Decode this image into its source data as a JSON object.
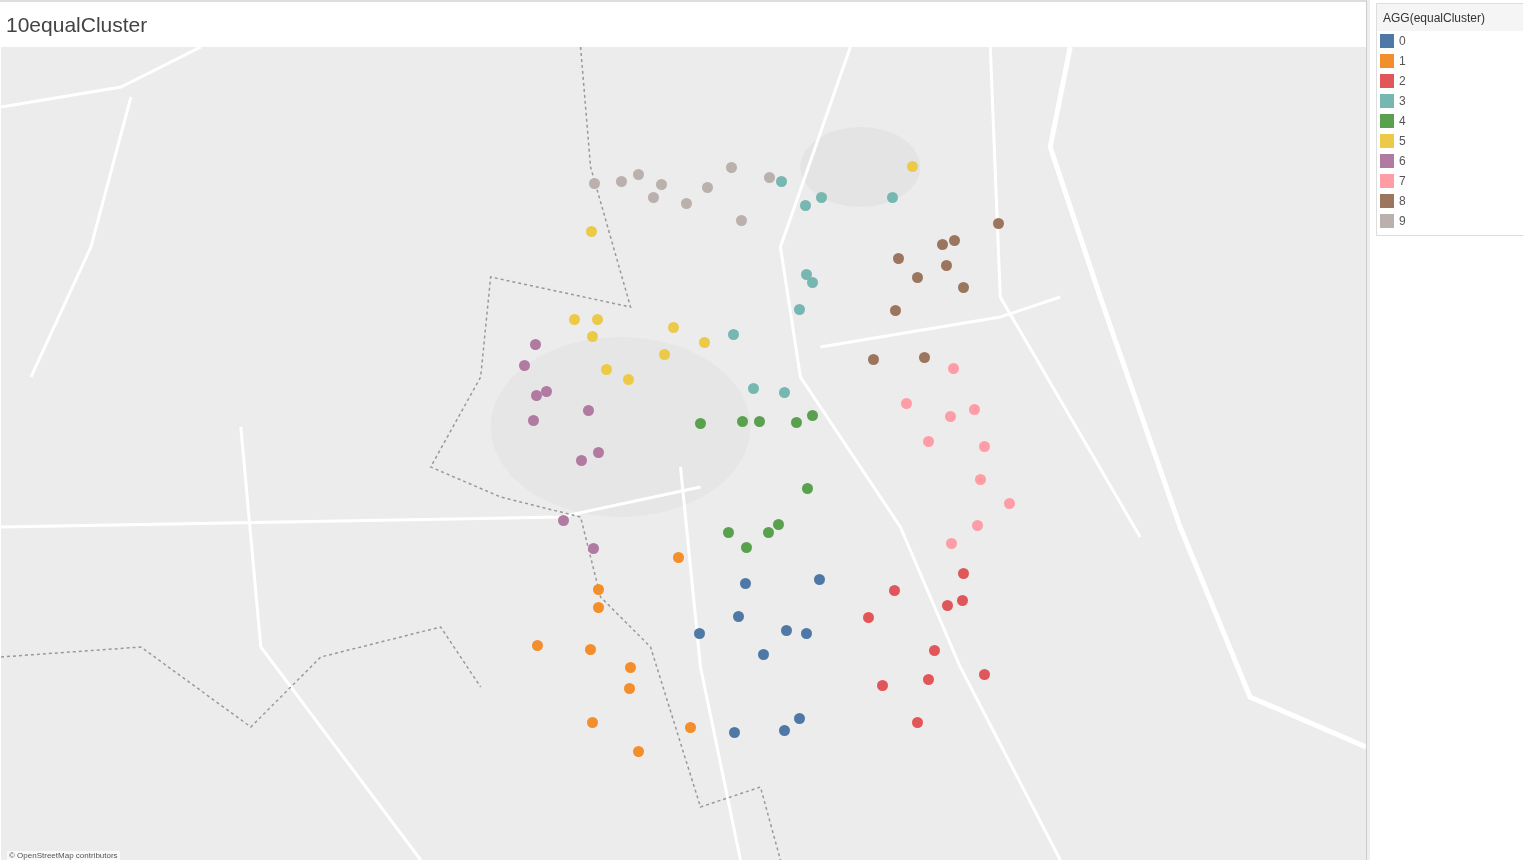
{
  "title": "10equalCluster",
  "map": {
    "attribution": "© OpenStreetMap contributors",
    "markers": [
      {
        "color": "#bab0ac"
      },
      {
        "color": "#bab0ac"
      },
      {
        "color": "#bab0ac"
      },
      {
        "color": "#bab0ac"
      },
      {
        "color": "#bab0ac"
      },
      {
        "color": "#bab0ac"
      },
      {
        "color": "#bab0ac"
      },
      {
        "color": "#bab0ac"
      },
      {
        "color": "#bab0ac"
      },
      {
        "color": "#bab0ac"
      },
      {
        "color": "#76b7b2"
      },
      {
        "color": "#76b7b2"
      },
      {
        "color": "#76b7b2"
      },
      {
        "color": "#76b7b2"
      },
      {
        "color": "#76b7b2"
      },
      {
        "color": "#76b7b2"
      },
      {
        "color": "#76b7b2"
      },
      {
        "color": "#76b7b2"
      },
      {
        "color": "#76b7b2"
      },
      {
        "color": "#76b7b2"
      },
      {
        "color": "#edc948"
      },
      {
        "color": "#edc948"
      },
      {
        "color": "#edc948"
      },
      {
        "color": "#edc948"
      },
      {
        "color": "#edc948"
      },
      {
        "color": "#edc948"
      },
      {
        "color": "#edc948"
      },
      {
        "color": "#edc948"
      },
      {
        "color": "#edc948"
      },
      {
        "color": "#edc948"
      },
      {
        "color": "#9c755f"
      },
      {
        "color": "#9c755f"
      },
      {
        "color": "#9c755f"
      },
      {
        "color": "#9c755f"
      },
      {
        "color": "#9c755f"
      },
      {
        "color": "#9c755f"
      },
      {
        "color": "#9c755f"
      },
      {
        "color": "#9c755f"
      },
      {
        "color": "#9c755f"
      },
      {
        "color": "#9c755f"
      },
      {
        "color": "#b07aa1"
      },
      {
        "color": "#b07aa1"
      },
      {
        "color": "#b07aa1"
      },
      {
        "color": "#b07aa1"
      },
      {
        "color": "#b07aa1"
      },
      {
        "color": "#b07aa1"
      },
      {
        "color": "#b07aa1"
      },
      {
        "color": "#b07aa1"
      },
      {
        "color": "#b07aa1"
      },
      {
        "color": "#b07aa1"
      },
      {
        "color": "#ff9da7"
      },
      {
        "color": "#ff9da7"
      },
      {
        "color": "#ff9da7"
      },
      {
        "color": "#ff9da7"
      },
      {
        "color": "#ff9da7"
      },
      {
        "color": "#ff9da7"
      },
      {
        "color": "#ff9da7"
      },
      {
        "color": "#ff9da7"
      },
      {
        "color": "#ff9da7"
      },
      {
        "color": "#ff9da7"
      },
      {
        "color": "#59a14f"
      },
      {
        "color": "#59a14f"
      },
      {
        "color": "#59a14f"
      },
      {
        "color": "#59a14f"
      },
      {
        "color": "#59a14f"
      },
      {
        "color": "#59a14f"
      },
      {
        "color": "#59a14f"
      },
      {
        "color": "#59a14f"
      },
      {
        "color": "#59a14f"
      },
      {
        "color": "#59a14f"
      },
      {
        "color": "#f28e2b"
      },
      {
        "color": "#f28e2b"
      },
      {
        "color": "#f28e2b"
      },
      {
        "color": "#f28e2b"
      },
      {
        "color": "#f28e2b"
      },
      {
        "color": "#f28e2b"
      },
      {
        "color": "#f28e2b"
      },
      {
        "color": "#f28e2b"
      },
      {
        "color": "#f28e2b"
      },
      {
        "color": "#f28e2b"
      },
      {
        "color": "#4e79a7"
      },
      {
        "color": "#4e79a7"
      },
      {
        "color": "#4e79a7"
      },
      {
        "color": "#4e79a7"
      },
      {
        "color": "#4e79a7"
      },
      {
        "color": "#4e79a7"
      },
      {
        "color": "#4e79a7"
      },
      {
        "color": "#4e79a7"
      },
      {
        "color": "#4e79a7"
      },
      {
        "color": "#4e79a7"
      },
      {
        "color": "#e15759"
      },
      {
        "color": "#e15759"
      },
      {
        "color": "#e15759"
      },
      {
        "color": "#e15759"
      },
      {
        "color": "#e15759"
      },
      {
        "color": "#e15759"
      },
      {
        "color": "#e15759"
      },
      {
        "color": "#e15759"
      },
      {
        "color": "#e15759"
      },
      {
        "color": "#e15759"
      }
    ]
  },
  "legend": {
    "title": "AGG(equalCluster)",
    "items": [
      {
        "label": "0",
        "color": "#4e79a7"
      },
      {
        "label": "1",
        "color": "#f28e2b"
      },
      {
        "label": "2",
        "color": "#e15759"
      },
      {
        "label": "3",
        "color": "#76b7b2"
      },
      {
        "label": "4",
        "color": "#59a14f"
      },
      {
        "label": "5",
        "color": "#edc948"
      },
      {
        "label": "6",
        "color": "#b07aa1"
      },
      {
        "label": "7",
        "color": "#ff9da7"
      },
      {
        "label": "8",
        "color": "#9c755f"
      },
      {
        "label": "9",
        "color": "#bab0ac"
      }
    ]
  }
}
